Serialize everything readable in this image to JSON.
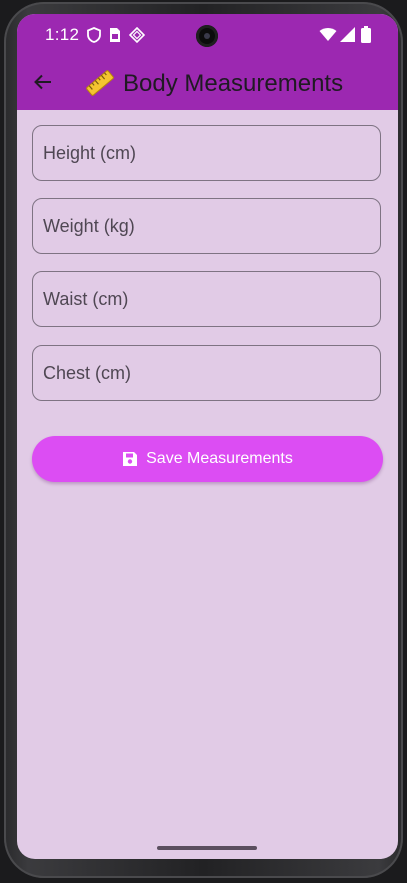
{
  "status_bar": {
    "time": "1:12",
    "left_icons": [
      "shield-icon",
      "sim-card-icon",
      "diamond-icon"
    ],
    "right_icons": [
      "wifi-icon",
      "signal-icon",
      "battery-icon"
    ]
  },
  "app_bar": {
    "back_icon": "arrow-left-icon",
    "title_emoji": "ruler-icon",
    "title": "Body Measurements",
    "background": "#9c28b1"
  },
  "form": {
    "fields": [
      {
        "placeholder": "Height (cm)",
        "value": ""
      },
      {
        "placeholder": "Weight (kg)",
        "value": ""
      },
      {
        "placeholder": "Waist (cm)",
        "value": ""
      },
      {
        "placeholder": "Chest (cm)",
        "value": ""
      }
    ],
    "save_button": {
      "label": "Save Measurements",
      "icon": "save-icon",
      "color": "#dc4df3"
    }
  },
  "theme": {
    "screen_background": "#e1cbe6"
  }
}
